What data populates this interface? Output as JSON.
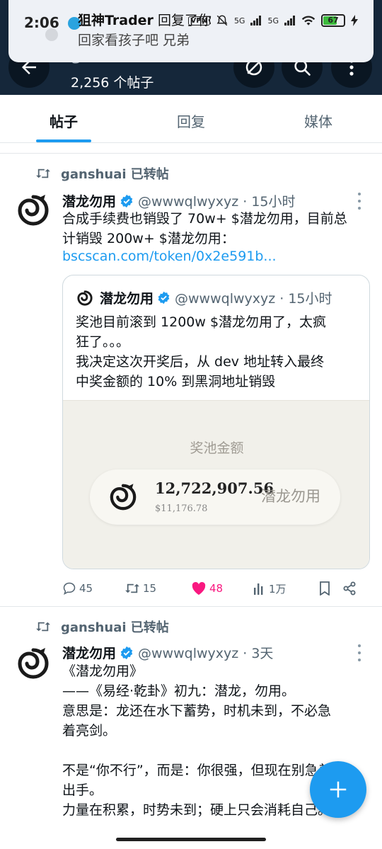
{
  "notification": {
    "time": "2:06",
    "sender": "狙神Trader",
    "action": " 回复了你",
    "message": "回家看孩子吧 兄弟",
    "vpn": "VPN",
    "battery": "67",
    "net1": "5G",
    "net2": "5G"
  },
  "header": {
    "title": "ganshuai",
    "post_count": "2,256 个帖子"
  },
  "tabs": [
    {
      "label": "帖子"
    },
    {
      "label": "回复"
    },
    {
      "label": "媒体"
    }
  ],
  "posts": [
    {
      "repost_text": "ganshuai 已转帖",
      "name": "潜龙勿用",
      "handle": "@wwwqlwyxyz · 15小时",
      "text": "合成手续费也销毁了 70w+ $潜龙勿用，目前总\n计销毁 200w+ $潜龙勿用：",
      "link": "bscscan.com/token/0x2e591b...",
      "quote": {
        "name": "潜龙勿用",
        "handle": "@wwwqlwyxyz · 15小时",
        "text": "奖池目前滚到 1200w $潜龙勿用了，太疯\n狂了。。。\n我决定这次开奖后，从 dev 地址转入最终\n中奖金额的 10% 到黑洞地址销毁",
        "image": {
          "label": "奖池金额",
          "amount": "12,722,907.56",
          "usd": "$11,176.78",
          "token": "潜龙勿用"
        }
      },
      "stats": {
        "replies": "45",
        "reposts": "15",
        "likes": "48",
        "views": "1万"
      }
    },
    {
      "repost_text": "ganshuai 已转帖",
      "name": "潜龙勿用",
      "handle": "@wwwqlwyxyz · 3天",
      "text": "《潜龙勿用》\n——《易经·乾卦》初九：潜龙，勿用。\n意思是：龙还在水下蓄势，时机未到，不必急\n着亮剑。\n\n不是“你不行”，而是：你很强，但现在别急着\n出手。\n力量在积累，时势未到；硬上只会消耗自己。"
    }
  ],
  "colors": {
    "accent": "#1d9bf0",
    "like": "#f91880",
    "header_bg": "#15273a"
  }
}
